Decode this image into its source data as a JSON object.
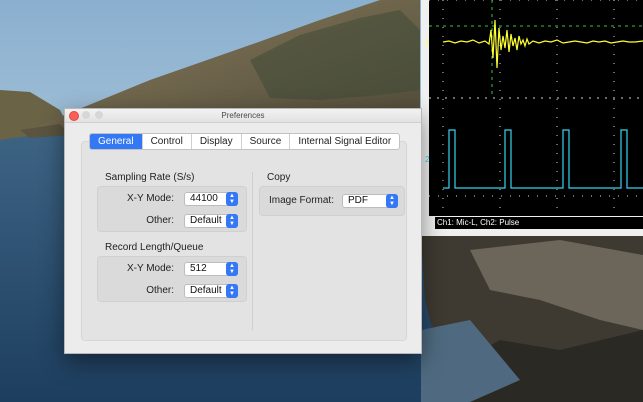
{
  "scope": {
    "ch1_label": "1",
    "ch2_label": "2",
    "caption": "Ch1: Mic-L, Ch2: Pulse",
    "ch1_color": "#ffff33",
    "ch2_color": "#33d6f0",
    "grid_color": "#ffffff"
  },
  "prefs": {
    "title": "Preferences",
    "tabs": [
      {
        "label": "General",
        "active": true
      },
      {
        "label": "Control",
        "active": false
      },
      {
        "label": "Display",
        "active": false
      },
      {
        "label": "Source",
        "active": false
      },
      {
        "label": "Internal Signal Editor",
        "active": false
      }
    ],
    "sampling": {
      "title": "Sampling Rate (S/s)",
      "xy_label": "X-Y Mode:",
      "xy_value": "44100",
      "other_label": "Other:",
      "other_value": "Default"
    },
    "record": {
      "title": "Record Length/Queue",
      "xy_label": "X-Y Mode:",
      "xy_value": "512",
      "other_label": "Other:",
      "other_value": "Default"
    },
    "copy": {
      "title": "Copy",
      "format_label": "Image Format:",
      "format_value": "PDF"
    },
    "accent_color": "#3478f6"
  }
}
